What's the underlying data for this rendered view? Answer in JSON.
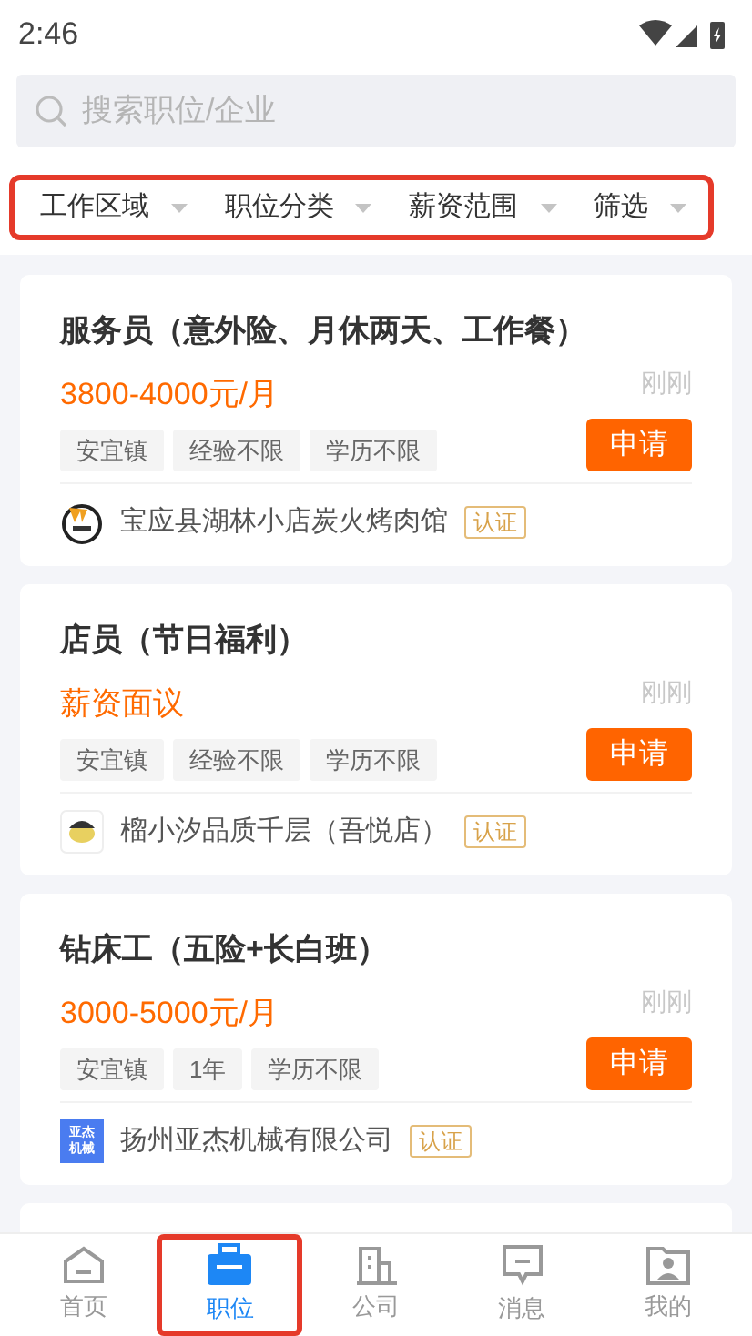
{
  "status_bar": {
    "time": "2:46"
  },
  "search": {
    "placeholder": "搜索职位/企业"
  },
  "filters": {
    "highlighted": true,
    "items": [
      {
        "label": "工作区域"
      },
      {
        "label": "职位分类"
      },
      {
        "label": "薪资范围"
      },
      {
        "label": "筛选"
      }
    ]
  },
  "jobs": [
    {
      "title": "服务员（意外险、月休两天、工作餐）",
      "salary": "3800-4000元/月",
      "time": "刚刚",
      "tags": [
        "安宜镇",
        "经验不限",
        "学历不限"
      ],
      "apply": "申请",
      "company": "宝应县湖林小店炭火烤肉馆",
      "badge": "认证",
      "logo": {
        "kind": "grill"
      }
    },
    {
      "title": "店员（节日福利）",
      "salary": "薪资面议",
      "time": "刚刚",
      "tags": [
        "安宜镇",
        "经验不限",
        "学历不限"
      ],
      "apply": "申请",
      "company": "榴小汐品质千层（吾悦店）",
      "badge": "认证",
      "logo": {
        "kind": "cartoon"
      }
    },
    {
      "title": "钻床工（五险+长白班）",
      "salary": "3000-5000元/月",
      "time": "刚刚",
      "tags": [
        "安宜镇",
        "1年",
        "学历不限"
      ],
      "apply": "申请",
      "company": "扬州亚杰机械有限公司",
      "badge": "认证",
      "logo": {
        "kind": "text",
        "text": "亚杰机械"
      }
    }
  ],
  "nav": [
    {
      "label": "首页",
      "kind": "home",
      "selected": false,
      "highlighted": false
    },
    {
      "label": "职位",
      "kind": "briefcase",
      "selected": true,
      "highlighted": true
    },
    {
      "label": "公司",
      "kind": "building",
      "selected": false,
      "highlighted": false
    },
    {
      "label": "消息",
      "kind": "message",
      "selected": false,
      "highlighted": false
    },
    {
      "label": "我的",
      "kind": "profile",
      "selected": false,
      "highlighted": false
    }
  ]
}
